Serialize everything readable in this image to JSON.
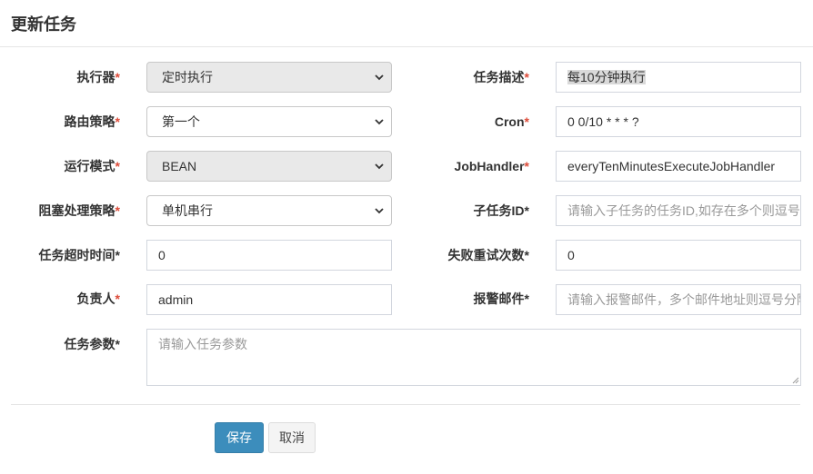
{
  "modal": {
    "title": "更新任务"
  },
  "form": {
    "executor": {
      "label": "执行器",
      "value": "定时执行"
    },
    "route_strategy": {
      "label": "路由策略",
      "value": "第一个"
    },
    "glue_type": {
      "label": "运行模式",
      "value": "BEAN"
    },
    "block_strategy": {
      "label": "阻塞处理策略",
      "value": "单机串行"
    },
    "timeout": {
      "label": "任务超时时间",
      "value": "0"
    },
    "author": {
      "label": "负责人",
      "value": "admin"
    },
    "job_param": {
      "label": "任务参数",
      "placeholder": "请输入任务参数"
    },
    "job_desc": {
      "label": "任务描述",
      "value": "每10分钟执行"
    },
    "cron": {
      "label": "Cron",
      "value": "0 0/10 * * * ?"
    },
    "job_handler": {
      "label": "JobHandler",
      "value": "everyTenMinutesExecuteJobHandler"
    },
    "child_job_id": {
      "label": "子任务ID",
      "placeholder": "请输入子任务的任务ID,如存在多个则逗号分隔"
    },
    "fail_retry": {
      "label": "失败重试次数",
      "value": "0"
    },
    "alarm_email": {
      "label": "报警邮件",
      "placeholder": "请输入报警邮件，多个邮件地址则逗号分隔"
    },
    "required_mark": "*"
  },
  "footer": {
    "save_label": "保存",
    "cancel_label": "取消"
  },
  "colors": {
    "primary": "#3c8dbc",
    "required": "#dd4b39"
  },
  "icons": {
    "select_arrow": "chevron-down-icon"
  }
}
